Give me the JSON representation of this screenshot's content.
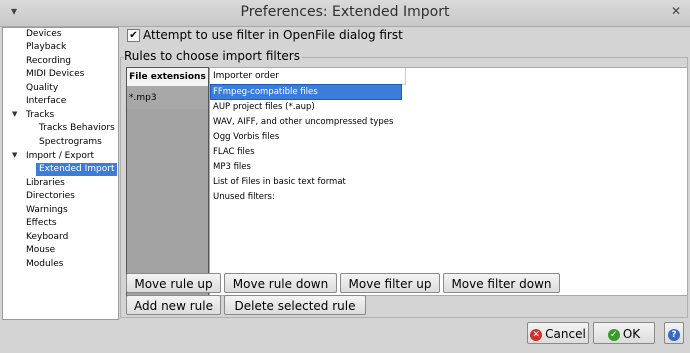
{
  "window": {
    "title": "Preferences: Extended Import"
  },
  "sidebar": {
    "items": [
      {
        "label": "Devices"
      },
      {
        "label": "Playback"
      },
      {
        "label": "Recording"
      },
      {
        "label": "MIDI Devices"
      },
      {
        "label": "Quality"
      },
      {
        "label": "Interface"
      },
      {
        "label": "Tracks"
      },
      {
        "label": "Tracks Behaviors"
      },
      {
        "label": "Spectrograms"
      },
      {
        "label": "Import / Export"
      },
      {
        "label": "Extended Import"
      },
      {
        "label": "Libraries"
      },
      {
        "label": "Directories"
      },
      {
        "label": "Warnings"
      },
      {
        "label": "Effects"
      },
      {
        "label": "Keyboard"
      },
      {
        "label": "Mouse"
      },
      {
        "label": "Modules"
      }
    ],
    "selected": "Extended Import"
  },
  "options": {
    "attempt_filter_label": "Attempt to use filter in OpenFile dialog first",
    "attempt_filter_checked": true
  },
  "rules": {
    "group_label": "Rules to choose import filters",
    "ext_header": "File extensions",
    "extensions": [
      "*.mp3"
    ],
    "order_header": "Importer order",
    "importers": [
      "FFmpeg-compatible files",
      "AUP project files (*.aup)",
      "WAV, AIFF, and other uncompressed types",
      "Ogg Vorbis files",
      "FLAC files",
      "MP3 files",
      "List of Files in basic text format",
      "Unused filters:"
    ],
    "selected_importer": "FFmpeg-compatible files"
  },
  "buttons": {
    "move_rule_up": "Move rule up",
    "move_rule_down": "Move rule down",
    "move_filter_up": "Move filter up",
    "move_filter_down": "Move filter down",
    "add_rule": "Add new rule",
    "delete_rule": "Delete selected rule",
    "cancel": "Cancel",
    "ok": "OK",
    "help": "?"
  },
  "icons": {
    "cancel": "cancel-icon",
    "ok": "checkmark-icon",
    "help": "help-icon"
  },
  "colors": {
    "selection": "#3b7dd8",
    "cancel_red": "#d0302b",
    "ok_green": "#3a9a2a",
    "help_blue": "#3568c8"
  }
}
